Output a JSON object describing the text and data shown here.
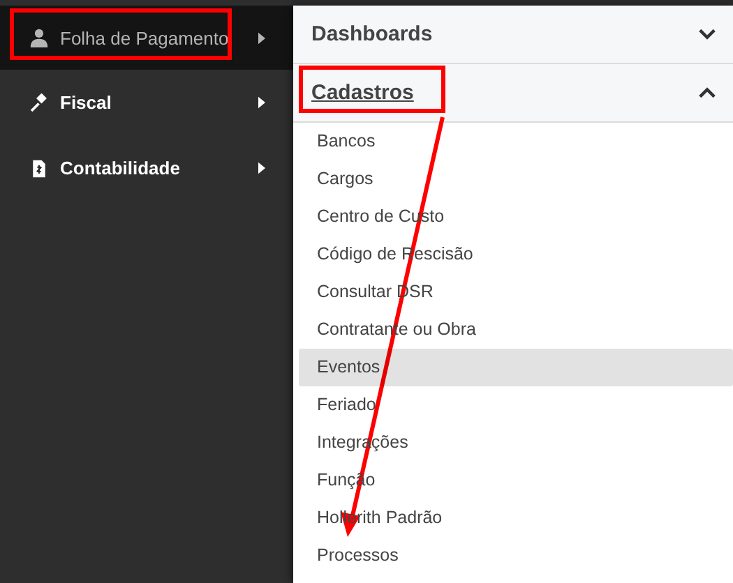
{
  "sidebar": {
    "items": [
      {
        "label": "Folha de Pagamento",
        "kind": "person",
        "selected": true
      },
      {
        "label": "Fiscal",
        "kind": "gavel",
        "selected": false
      },
      {
        "label": "Contabilidade",
        "kind": "document",
        "selected": false
      }
    ]
  },
  "menu": {
    "sections": [
      {
        "title": "Dashboards",
        "expanded": false,
        "underlined": false
      },
      {
        "title": "Cadastros",
        "expanded": true,
        "underlined": true,
        "items": [
          {
            "label": "Bancos",
            "highlighted": false
          },
          {
            "label": "Cargos",
            "highlighted": false
          },
          {
            "label": "Centro de Custo",
            "highlighted": false
          },
          {
            "label": "Código de Rescisão",
            "highlighted": false
          },
          {
            "label": "Consultar DSR",
            "highlighted": false
          },
          {
            "label": "Contratante ou Obra",
            "highlighted": false
          },
          {
            "label": "Eventos",
            "highlighted": true
          },
          {
            "label": "Feriado",
            "highlighted": false
          },
          {
            "label": "Integrações",
            "highlighted": false
          },
          {
            "label": "Função",
            "highlighted": false
          },
          {
            "label": "Hollerith Padrão",
            "highlighted": false
          },
          {
            "label": "Processos",
            "highlighted": false
          }
        ]
      }
    ]
  }
}
